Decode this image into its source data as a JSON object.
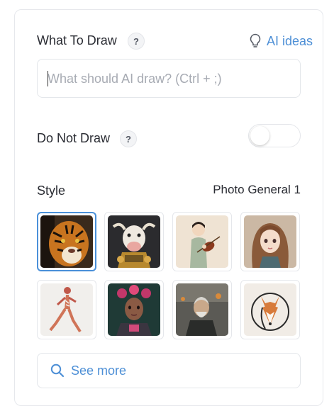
{
  "what_to_draw": {
    "label": "What To Draw",
    "help": "?",
    "ai_ideas_label": "AI ideas",
    "placeholder": "What should AI draw? (Ctrl + ;)",
    "value": ""
  },
  "do_not_draw": {
    "label": "Do Not Draw",
    "help": "?",
    "enabled": false
  },
  "style": {
    "label": "Style",
    "selected": "Photo General 1",
    "thumbnails": [
      {
        "subject": "tiger",
        "selected": true
      },
      {
        "subject": "robot-cow",
        "selected": false
      },
      {
        "subject": "violinist",
        "selected": false
      },
      {
        "subject": "anime-girl",
        "selected": false
      },
      {
        "subject": "dancer-figure",
        "selected": false
      },
      {
        "subject": "cyber-woman",
        "selected": false
      },
      {
        "subject": "old-man",
        "selected": false
      },
      {
        "subject": "fox-logo",
        "selected": false
      }
    ]
  },
  "see_more_label": "See more",
  "colors": {
    "accent": "#4d8fd6",
    "selected_border": "#4a90d9",
    "text": "#2a2c33",
    "placeholder": "#a7abb3"
  }
}
